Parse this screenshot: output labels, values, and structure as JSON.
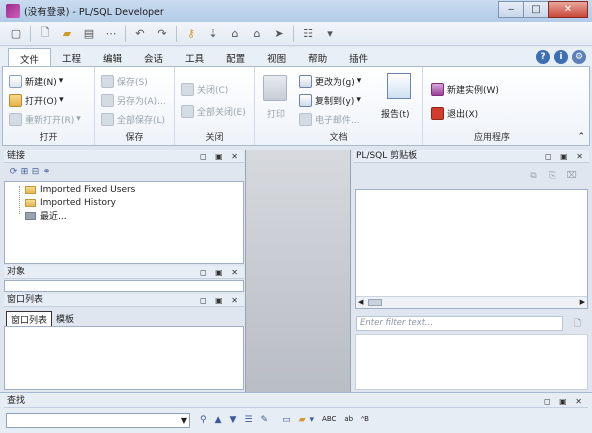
{
  "window": {
    "title": "(没有登录) - PL/SQL Developer"
  },
  "tabs": [
    "文件",
    "工程",
    "编辑",
    "会话",
    "工具",
    "配置",
    "视图",
    "帮助",
    "插件"
  ],
  "ribbon": {
    "open_group": {
      "label": "打开",
      "new": "新建(N)",
      "open": "打开(O)",
      "reopen": "重新打开(R)"
    },
    "save_group": {
      "label": "保存",
      "save": "保存(S)",
      "save_as": "另存为(A)...",
      "save_all": "全部保存(L)"
    },
    "close_group": {
      "label": "关闭",
      "close": "关闭(C)",
      "close_all": "全部关闭(E)"
    },
    "doc_group": {
      "label": "文档",
      "print": "打印",
      "change_to": "更改为(g)",
      "copy_to": "复制到(y)",
      "email": "电子邮件...",
      "report": "报告(t)"
    },
    "app_group": {
      "label": "应用程序",
      "new_instance": "新建实例(W)",
      "exit": "退出(X)"
    }
  },
  "connection_pane": {
    "title": "链接",
    "items": [
      "Imported Fixed Users",
      "Imported History",
      "最近..."
    ]
  },
  "objects_pane": {
    "title": "对象"
  },
  "window_list_pane": {
    "title": "窗口列表",
    "tabs": [
      "窗口列表",
      "模板"
    ]
  },
  "clipboard_pane": {
    "title": "PL/SQL 剪贴板",
    "filter_placeholder": "Enter filter text..."
  },
  "find_bar": {
    "title": "查找"
  }
}
